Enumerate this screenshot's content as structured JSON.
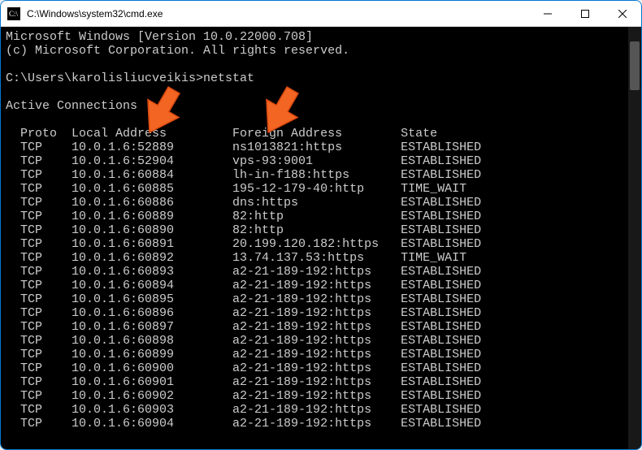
{
  "window": {
    "title": "C:\\Windows\\system32\\cmd.exe"
  },
  "header": {
    "line1": "Microsoft Windows [Version 10.0.22000.708]",
    "line2": "(c) Microsoft Corporation. All rights reserved."
  },
  "prompt": {
    "path": "C:\\Users\\karolisliucveikis>",
    "command": "netstat"
  },
  "section_title": "Active Connections",
  "columns": {
    "proto": "Proto",
    "local": "Local Address",
    "foreign": "Foreign Address",
    "state": "State"
  },
  "rows": [
    {
      "proto": "TCP",
      "local": "10.0.1.6:52889",
      "foreign": "ns1013821:https",
      "state": "ESTABLISHED"
    },
    {
      "proto": "TCP",
      "local": "10.0.1.6:52904",
      "foreign": "vps-93:9001",
      "state": "ESTABLISHED"
    },
    {
      "proto": "TCP",
      "local": "10.0.1.6:60884",
      "foreign": "lh-in-f188:https",
      "state": "ESTABLISHED"
    },
    {
      "proto": "TCP",
      "local": "10.0.1.6:60885",
      "foreign": "195-12-179-40:http",
      "state": "TIME_WAIT"
    },
    {
      "proto": "TCP",
      "local": "10.0.1.6:60886",
      "foreign": "dns:https",
      "state": "ESTABLISHED"
    },
    {
      "proto": "TCP",
      "local": "10.0.1.6:60889",
      "foreign": "82:http",
      "state": "ESTABLISHED"
    },
    {
      "proto": "TCP",
      "local": "10.0.1.6:60890",
      "foreign": "82:http",
      "state": "ESTABLISHED"
    },
    {
      "proto": "TCP",
      "local": "10.0.1.6:60891",
      "foreign": "20.199.120.182:https",
      "state": "ESTABLISHED"
    },
    {
      "proto": "TCP",
      "local": "10.0.1.6:60892",
      "foreign": "13.74.137.53:https",
      "state": "TIME_WAIT"
    },
    {
      "proto": "TCP",
      "local": "10.0.1.6:60893",
      "foreign": "a2-21-189-192:https",
      "state": "ESTABLISHED"
    },
    {
      "proto": "TCP",
      "local": "10.0.1.6:60894",
      "foreign": "a2-21-189-192:https",
      "state": "ESTABLISHED"
    },
    {
      "proto": "TCP",
      "local": "10.0.1.6:60895",
      "foreign": "a2-21-189-192:https",
      "state": "ESTABLISHED"
    },
    {
      "proto": "TCP",
      "local": "10.0.1.6:60896",
      "foreign": "a2-21-189-192:https",
      "state": "ESTABLISHED"
    },
    {
      "proto": "TCP",
      "local": "10.0.1.6:60897",
      "foreign": "a2-21-189-192:https",
      "state": "ESTABLISHED"
    },
    {
      "proto": "TCP",
      "local": "10.0.1.6:60898",
      "foreign": "a2-21-189-192:https",
      "state": "ESTABLISHED"
    },
    {
      "proto": "TCP",
      "local": "10.0.1.6:60899",
      "foreign": "a2-21-189-192:https",
      "state": "ESTABLISHED"
    },
    {
      "proto": "TCP",
      "local": "10.0.1.6:60900",
      "foreign": "a2-21-189-192:https",
      "state": "ESTABLISHED"
    },
    {
      "proto": "TCP",
      "local": "10.0.1.6:60901",
      "foreign": "a2-21-189-192:https",
      "state": "ESTABLISHED"
    },
    {
      "proto": "TCP",
      "local": "10.0.1.6:60902",
      "foreign": "a2-21-189-192:https",
      "state": "ESTABLISHED"
    },
    {
      "proto": "TCP",
      "local": "10.0.1.6:60903",
      "foreign": "a2-21-189-192:https",
      "state": "ESTABLISHED"
    },
    {
      "proto": "TCP",
      "local": "10.0.1.6:60904",
      "foreign": "a2-21-189-192:https",
      "state": "ESTABLISHED"
    }
  ],
  "annotations": {
    "arrow_color": "#f26522"
  }
}
